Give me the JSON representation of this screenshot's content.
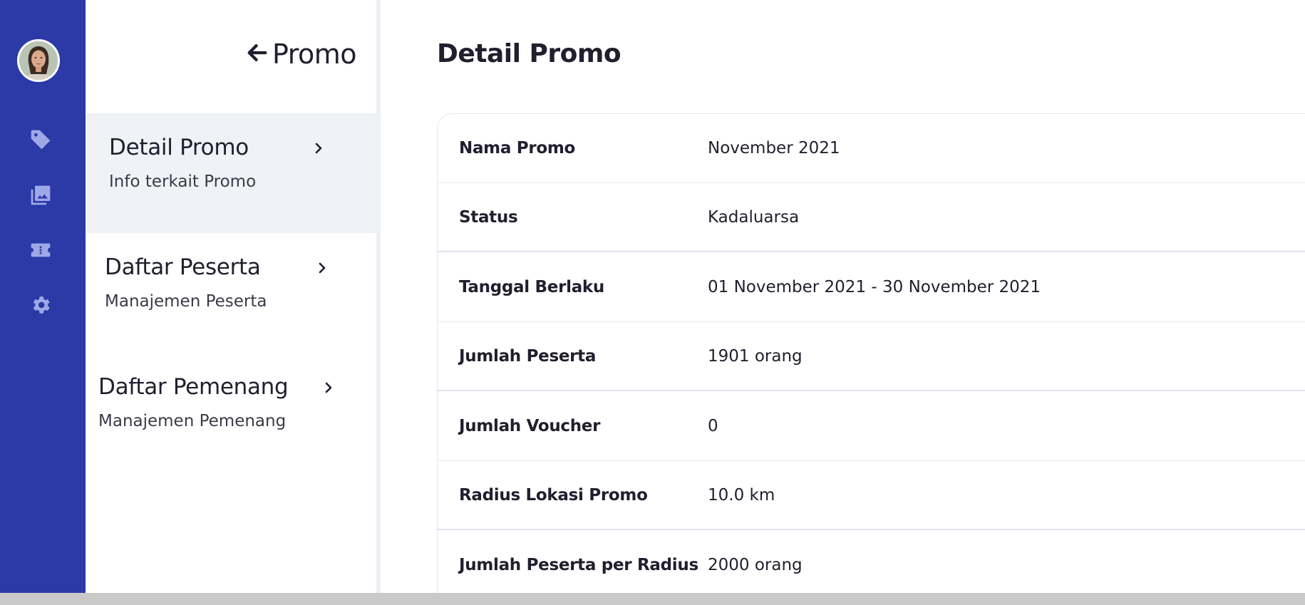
{
  "rail": {
    "icons": [
      "tag-icon",
      "image-gallery-icon",
      "ticket-icon",
      "gear-icon"
    ]
  },
  "sidebar": {
    "back_label": "Promo",
    "items": [
      {
        "title": "Detail Promo",
        "subtitle": "Info terkait Promo",
        "active": true
      },
      {
        "title": "Daftar Peserta",
        "subtitle": "Manajemen Peserta",
        "active": false
      },
      {
        "title": "Daftar Pemenang",
        "subtitle": "Manajemen Pemenang",
        "active": false
      }
    ]
  },
  "main": {
    "title": "Detail Promo",
    "rows": [
      {
        "label": "Nama Promo",
        "value": "November 2021"
      },
      {
        "label": "Status",
        "value": "Kadaluarsa"
      },
      {
        "label": "Tanggal Berlaku",
        "value": "01 November 2021 - 30 November 2021"
      },
      {
        "label": "Jumlah Peserta",
        "value": "1901 orang"
      },
      {
        "label": "Jumlah Voucher",
        "value": "0"
      },
      {
        "label": "Radius Lokasi Promo",
        "value": "10.0 km"
      },
      {
        "label": "Jumlah Peserta per Radius",
        "value": "2000 orang"
      }
    ]
  },
  "colors": {
    "rail_bg": "#2b3aa7",
    "rail_icon": "#9fa8e6",
    "active_item_bg": "#f1f2f7",
    "text": "#1f1f2e"
  }
}
